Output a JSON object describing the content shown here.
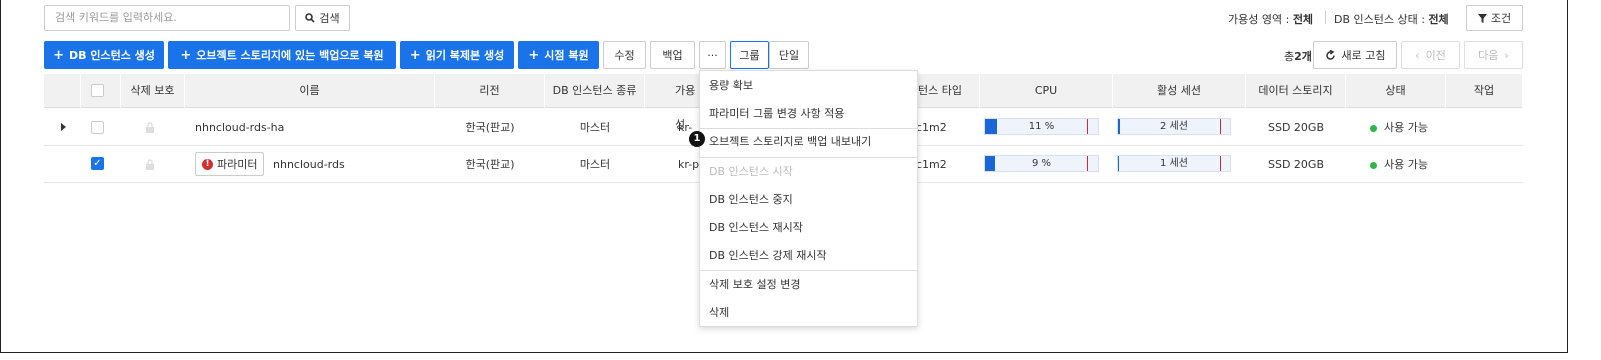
{
  "search": {
    "placeholder": "검색 키워드를 입력하세요.",
    "button_label": "검색"
  },
  "filters": {
    "availability_label": "가용성 영역 :",
    "availability_value": "전체",
    "status_label": "DB 인스턴스 상태 :",
    "status_value": "전체",
    "condition_label": "조건"
  },
  "toolbar": {
    "create_db": "DB 인스턴스 생성",
    "restore_object_storage": "오브젝트 스토리지에 있는 백업으로 복원",
    "create_read_replica": "읽기 복제본 생성",
    "pitr": "시점 복원",
    "edit": "수정",
    "backup": "백업",
    "more": "···",
    "group": "그룹",
    "single": "단일",
    "count_prefix": "총",
    "count_value": "2개",
    "refresh": "새로 고침",
    "prev": "이전",
    "next": "다음"
  },
  "table": {
    "headers": {
      "delete_protect": "삭제 보호",
      "name": "이름",
      "region": "리전",
      "type": "DB 인스턴스 종류",
      "az": "가용성",
      "flavor": "턴스 타입",
      "cpu": "CPU",
      "sessions": "활성 세션",
      "storage": "데이터 스토리지",
      "status": "상태",
      "action": "작업"
    },
    "rows": [
      {
        "name": "nhncloud-rds-ha",
        "region": "한국(판교)",
        "type": "마스터",
        "az": "kr-",
        "flavor": "c1m2",
        "cpu_label": "11 %",
        "cpu_pct": 11,
        "sessions_label": "2 세션",
        "sessions_pct": 2,
        "storage": "SSD 20GB",
        "status": "사용 가능",
        "checked": false
      },
      {
        "param_tag": "파라미터",
        "name": "nhncloud-rds",
        "region": "한국(판교)",
        "type": "마스터",
        "az": "kr-p",
        "flavor": "c1m2",
        "cpu_label": "9 %",
        "cpu_pct": 9,
        "sessions_label": "1 세션",
        "sessions_pct": 1,
        "storage": "SSD 20GB",
        "status": "사용 가능",
        "checked": true
      }
    ]
  },
  "menu": {
    "items": [
      "용량 확보",
      "파라미터 그룹 변경 사항 적용",
      "오브젝트 스토리지로 백업 내보내기",
      "DB 인스턴스 시작",
      "DB 인스턴스 중지",
      "DB 인스턴스 재시작",
      "DB 인스턴스 강제 재시작",
      "삭제 보호 설정 변경",
      "삭제"
    ]
  },
  "annotation": {
    "badge": "1"
  },
  "colors": {
    "primary": "#1a73e8",
    "status_ok": "#2eb54a",
    "danger": "#d32f2f"
  }
}
